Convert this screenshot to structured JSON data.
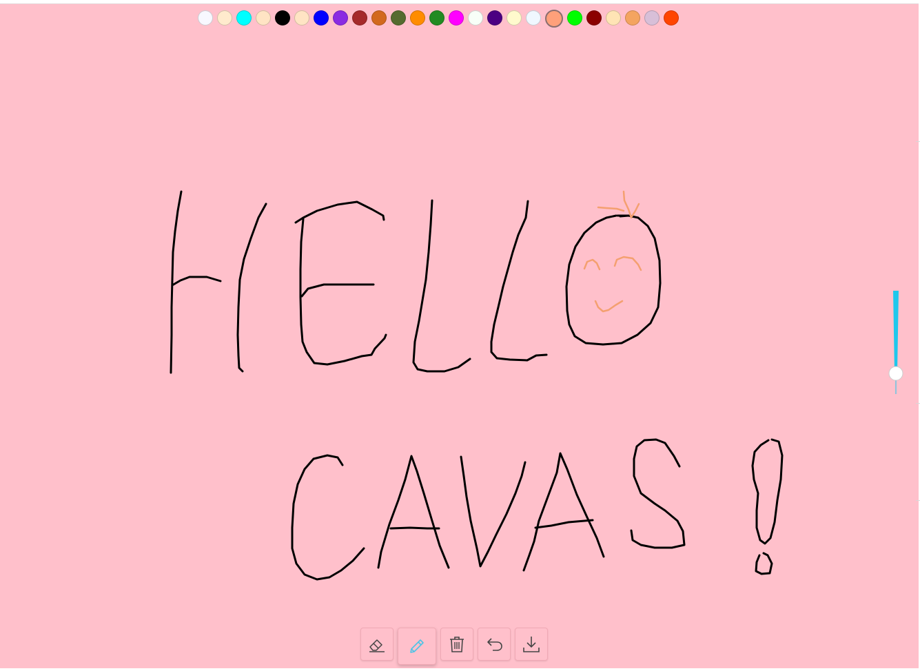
{
  "palette": {
    "colors": [
      "#f8f8ff",
      "#ffebcd",
      "#00ffff",
      "#ffe4c4",
      "#000000",
      "#ffe4c4",
      "#0000ff",
      "#8a2be2",
      "#a52a2a",
      "#d2691e",
      "#556b2f",
      "#ff8c00",
      "#228b22",
      "#ff00ff",
      "#f8fff8",
      "#4b0082",
      "#fffacd",
      "#f0f8ff",
      "#ffa07a",
      "#00ff00",
      "#8b0000",
      "#ffe4b5",
      "#f4a460",
      "#d8bfd8",
      "#ff4500"
    ],
    "selected_index": 18
  },
  "canvas": {
    "background": "#ffc0cb",
    "stroke_color_primary": "#000000",
    "stroke_color_accent": "#f4a070"
  },
  "brush_size": {
    "level": 0.2,
    "track_color": "#1ec8ec"
  },
  "toolbar": {
    "tools": [
      {
        "name": "eraser-button",
        "icon": "eraser-icon",
        "active": false
      },
      {
        "name": "pencil-button",
        "icon": "pencil-icon",
        "active": true
      },
      {
        "name": "clear-button",
        "icon": "trash-icon",
        "active": false
      },
      {
        "name": "undo-button",
        "icon": "undo-icon",
        "active": false
      },
      {
        "name": "download-button",
        "icon": "download-icon",
        "active": false
      }
    ],
    "active_color": "#4cc3e6",
    "icon_color": "#444444"
  }
}
